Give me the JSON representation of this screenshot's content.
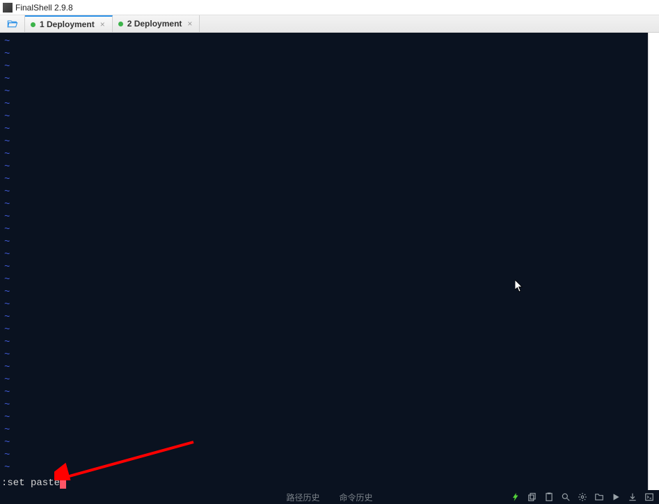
{
  "title_bar": {
    "app_title": "FinalShell 2.9.8"
  },
  "tab_bar": {
    "tabs": [
      {
        "label": "1 Deployment",
        "status": "connected",
        "active": true
      },
      {
        "label": "2 Deployment",
        "status": "connected",
        "active": false
      }
    ]
  },
  "terminal": {
    "tilde_count": 35,
    "command_line": ":set paste"
  },
  "status_bar": {
    "center_items": [
      "路径历史",
      "命令历史"
    ],
    "icon_names": [
      "bolt-icon",
      "copy-icon",
      "clipboard-icon",
      "search-icon",
      "gear-icon",
      "folder-icon",
      "play-icon",
      "download-icon",
      "terminal-icon"
    ]
  },
  "colors": {
    "terminal_bg": "#0a1220",
    "tilde": "#4d6bff",
    "cursor": "#ff5566",
    "active_tab_accent": "#2a8fe6",
    "status_dot": "#3cb34a",
    "bolt": "#54d43a",
    "arrow": "#ff0000"
  }
}
